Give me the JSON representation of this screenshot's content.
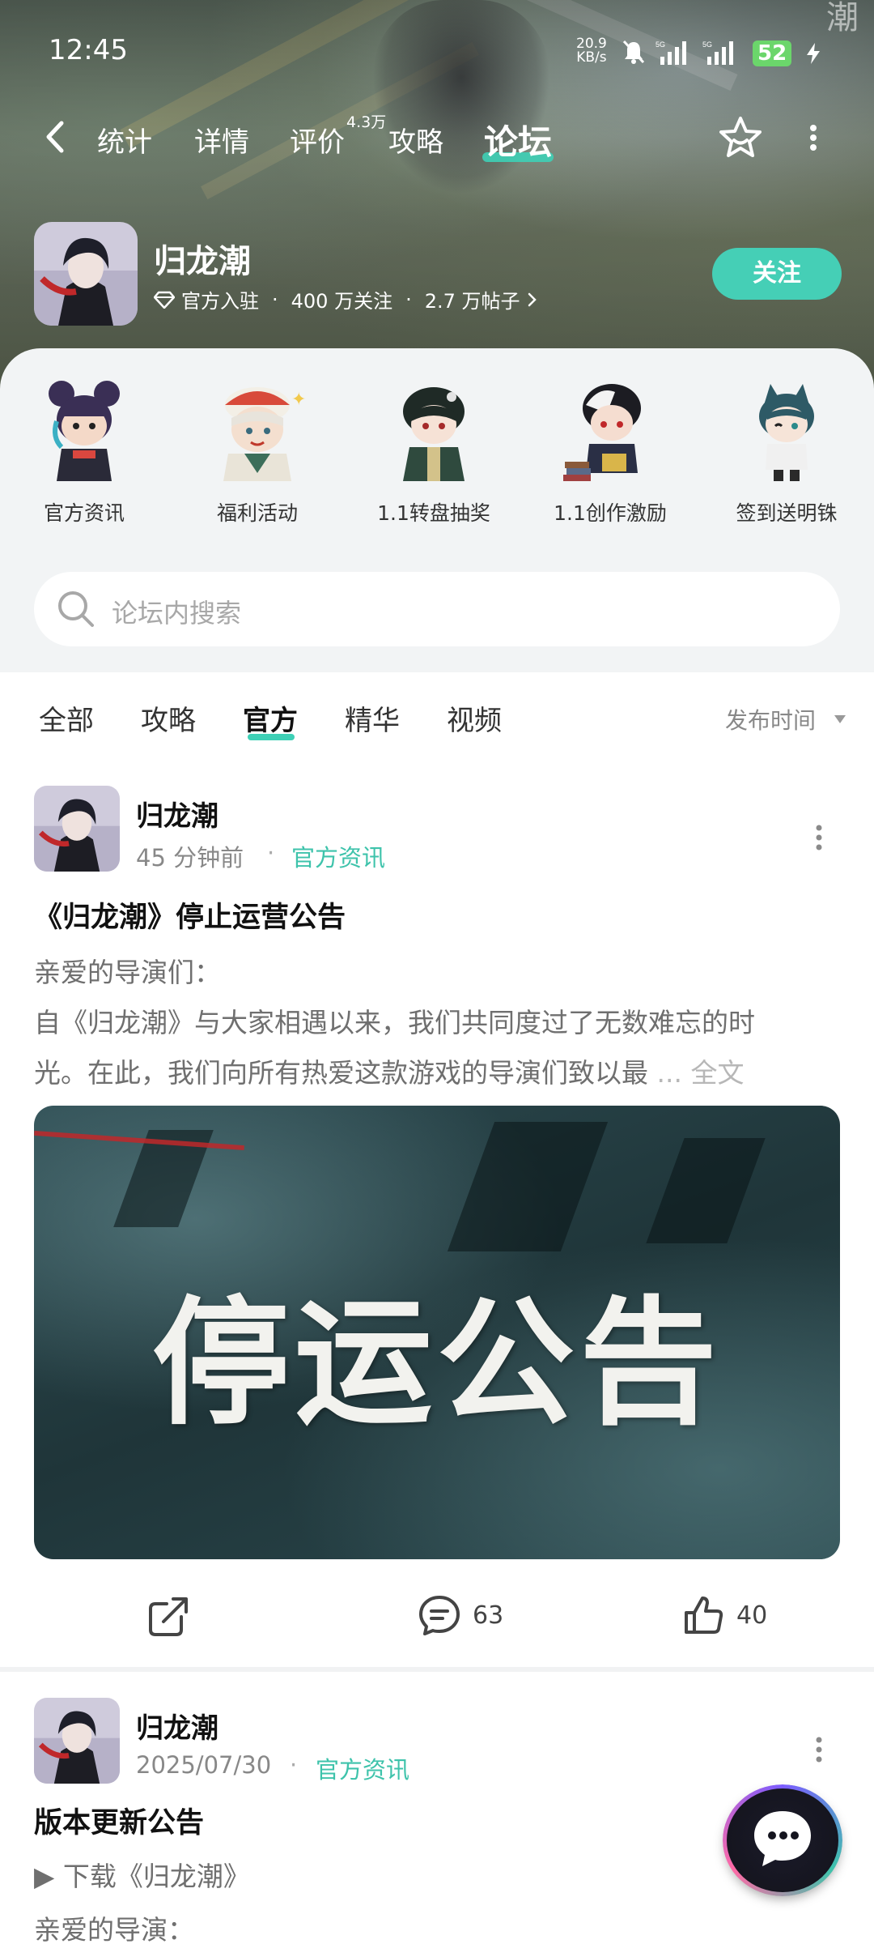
{
  "status_bar": {
    "time": "12:45",
    "net_speed_value": "20.9",
    "net_speed_unit": "KB/s",
    "signal_label_1": "5G",
    "signal_label_2": "5G",
    "battery": "52"
  },
  "nav": {
    "tabs": [
      "统计",
      "详情",
      "评价",
      "攻略",
      "论坛"
    ],
    "active_tab": "论坛",
    "review_count": "4.3万"
  },
  "game": {
    "title": "归龙潮",
    "official_badge": "官方入驻",
    "followers": "400 万关注",
    "posts": "2.7 万帖子",
    "follow_label": "关注"
  },
  "quick_entries": [
    {
      "label": "官方资讯",
      "icon": "chibi-character-icon"
    },
    {
      "label": "福利活动",
      "icon": "chibi-character-icon"
    },
    {
      "label": "1.1转盘抽奖",
      "icon": "chibi-character-icon"
    },
    {
      "label": "1.1创作激励",
      "icon": "chibi-character-icon"
    },
    {
      "label": "签到送明铢",
      "icon": "chibi-character-icon"
    }
  ],
  "search": {
    "placeholder": "论坛内搜索"
  },
  "filters": {
    "tabs": [
      "全部",
      "攻略",
      "官方",
      "精华",
      "视频"
    ],
    "active": "官方",
    "sort_label": "发布时间"
  },
  "posts": [
    {
      "author": "归龙潮",
      "time": "45 分钟前",
      "category": "官方资讯",
      "title": "《归龙潮》停止运营公告",
      "body_line_1": "亲爱的导演们：",
      "body_line_2": "自《归龙潮》与大家相遇以来，我们共同度过了无数难忘的时",
      "body_line_3": "光。在此，我们向所有热爱这款游戏的导演们致以最",
      "read_more": "... 全文",
      "cover_text": "停运公告",
      "comments": "63",
      "likes": "40"
    },
    {
      "author": "归龙潮",
      "time": "2025/07/30",
      "category": "官方资讯",
      "title": "版本更新公告",
      "body_line_1": "▶ 下载《归龙潮》",
      "body_line_2": "亲爱的导演："
    }
  ],
  "colors": {
    "accent": "#45cfb6",
    "category_text": "#3ec3ab",
    "panel_bg": "#f2f4f5"
  }
}
